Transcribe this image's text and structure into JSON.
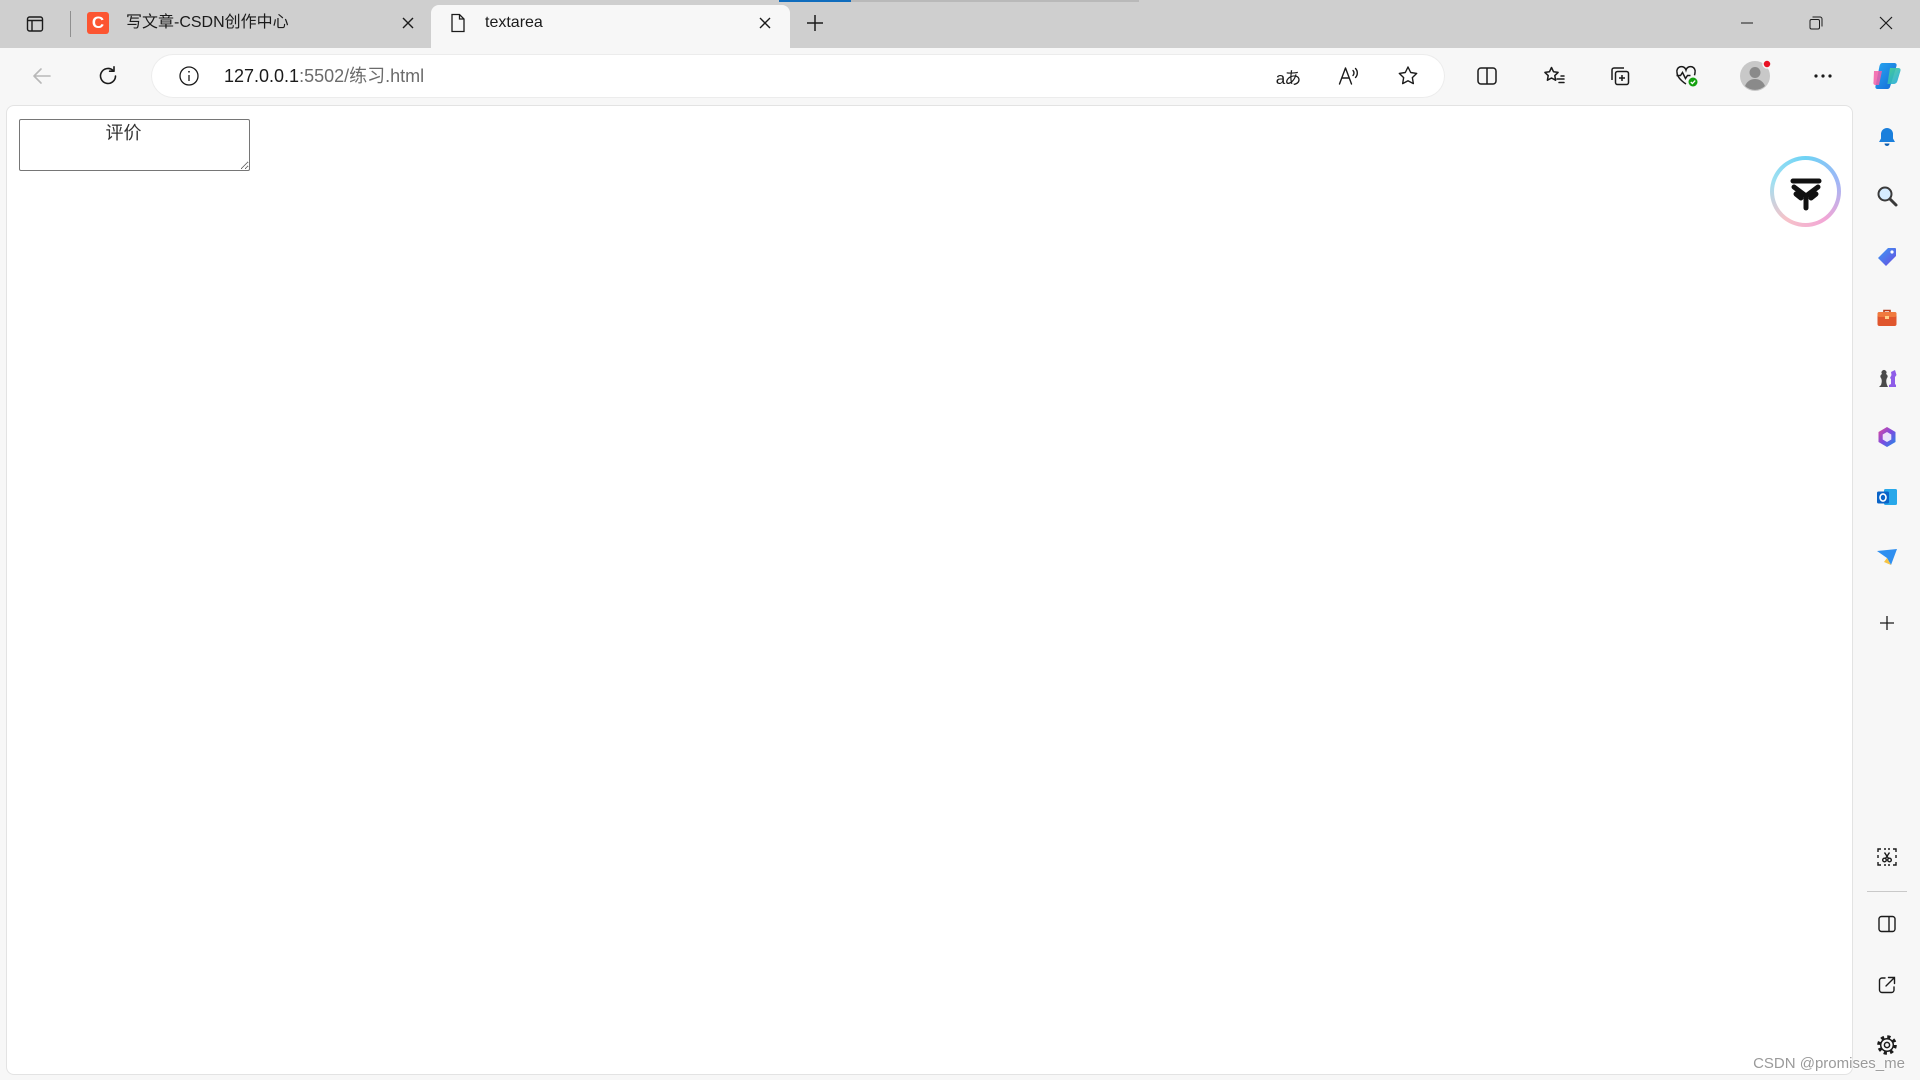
{
  "colors": {
    "tab_strip_bg": "#cfcfcf",
    "toolbar_bg": "#f7f7f7",
    "page_bg": "#ffffff",
    "csdn_brand": "#fc5531",
    "accent": "#0f6cbd",
    "notification_dot": "#e81123"
  },
  "tab_strip": {
    "actions_icon": "tab-actions-icon",
    "new_tab_icon": "plus-icon",
    "tabs": [
      {
        "title": "写文章-CSDN创作中心",
        "favicon_letter": "C",
        "favicon_icon": "csdn-logo-icon",
        "active": false,
        "close_icon": "close-icon"
      },
      {
        "title": "textarea",
        "favicon_icon": "document-icon",
        "active": true,
        "close_icon": "close-icon"
      }
    ]
  },
  "window_controls": [
    "minimize-icon",
    "restore-icon",
    "close-icon"
  ],
  "toolbar": {
    "nav_icons": [
      "back-arrow-icon",
      "refresh-icon"
    ],
    "address": {
      "site_info_icon": "info-icon",
      "url_host": "127.0.0.1",
      "url_rest": ":5502/练习.html"
    },
    "translate_glyph": "aあ",
    "address_actions": [
      "translate-icon",
      "read-aloud-icon",
      "favorite-star-icon"
    ],
    "actions": [
      "split-screen-icon",
      "favorites-icon",
      "collections-icon",
      "browser-essentials-icon",
      "profile-avatar-icon",
      "more-icon",
      "copilot-icon"
    ]
  },
  "page": {
    "textarea_value": "评价",
    "floating_extension_icon": "extension-assistant-icon"
  },
  "sidebar": {
    "top_icons": [
      "bell-icon",
      "search-icon",
      "shopping-tag-icon",
      "tools-icon",
      "games-icon",
      "microsoft-365-icon",
      "outlook-icon",
      "drop-icon",
      "add-icon"
    ],
    "bottom_icons": [
      "screenshot-icon",
      "hide-sidebar-icon",
      "open-external-icon",
      "settings-gear-icon"
    ]
  },
  "watermark": "CSDN @promises_me"
}
